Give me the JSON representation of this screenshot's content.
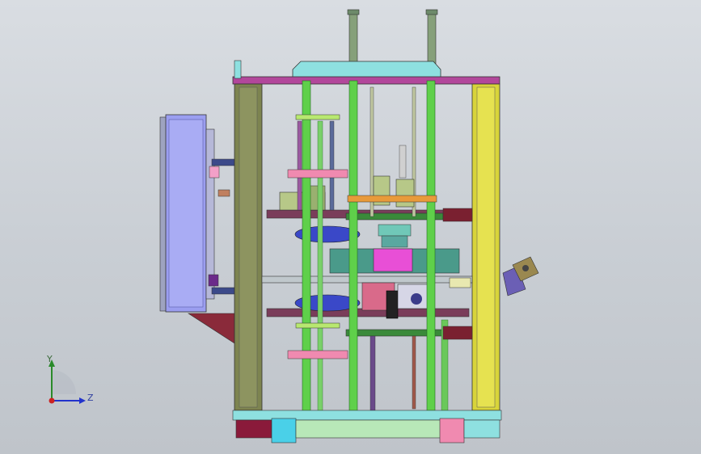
{
  "view": {
    "orientation_triad": {
      "x_axis_label": "Y",
      "z_axis_label": "Z",
      "x_axis_color": "#2a8a2a",
      "z_axis_color": "#2233cc",
      "origin_color": "#cc2222"
    }
  },
  "colors": {
    "background_top": "#d9dde2",
    "background_bottom": "#bfc4ca",
    "column_olive": "#7d8450",
    "column_yellow": "#d8d43a",
    "rod_green": "#5fd04a",
    "panel_lavender": "#9b9ef0",
    "plate_magenta": "#b2479b",
    "top_cyan": "#8ee0e0",
    "block_pink": "#e84fd6",
    "motor_purple": "#6b5fb5"
  }
}
